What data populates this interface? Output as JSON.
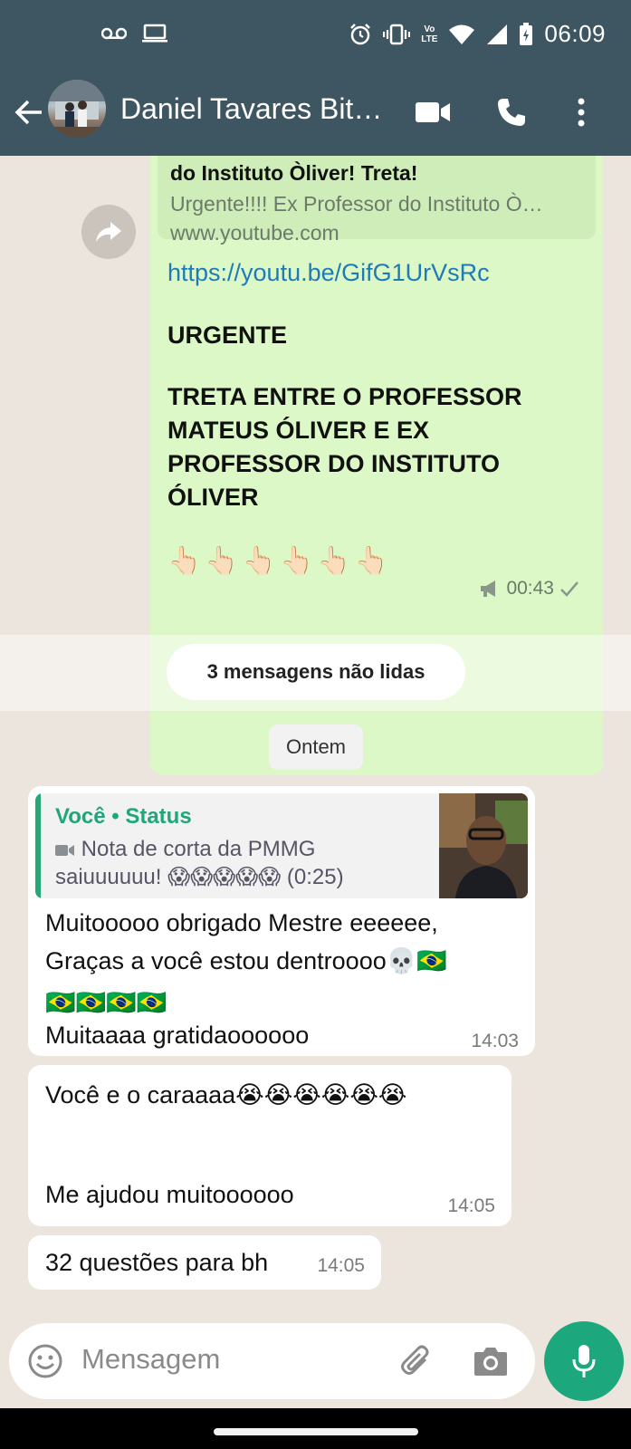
{
  "status_bar": {
    "time": "06:09",
    "network_label_top": "Vo",
    "network_label_bottom": "LTE"
  },
  "header": {
    "contact_name": "Daniel Tavares Bit…",
    "icons": [
      "back-arrow-icon",
      "video-call-icon",
      "phone-icon",
      "more-vert-icon"
    ]
  },
  "outgoing_message": {
    "link_preview": {
      "title": "do Instituto Òliver! Treta!",
      "description": "Urgente!!!! Ex Professor do Instituto Ò…",
      "domain": "www.youtube.com"
    },
    "link_url": "https://youtu.be/GifG1UrVsRc",
    "line_urgente": "URGENTE",
    "line_treta_1": "TRETA ENTRE O PROFESSOR",
    "line_treta_2": "MATEUS ÓLIVER E EX",
    "line_treta_3": "PROFESSOR DO INSTITUTO",
    "line_treta_4": "ÓLIVER",
    "pointers": "👆🏻👆🏻👆🏻👆🏻👆🏻👆🏻",
    "time": "00:43"
  },
  "unread_banner": "3 mensagens não lidas",
  "date_chip": "Ontem",
  "incoming_messages": [
    {
      "quote_author": "Você • Status",
      "quote_text": "Nota de corta da PMMG saiuuuuuu! 😱😱😱😱😱 (0:25)",
      "line1": "Muitooooo obrigado Mestre eeeeee,",
      "line2": "Graças a você estou dentroooo💀🇧🇷",
      "line3": "🇧🇷🇧🇷🇧🇷🇧🇷",
      "line4": "Muitaaaa gratidaoooooo",
      "time": "14:03"
    },
    {
      "line1": "Você e o caraaaa😭😭😭😭😭😭",
      "line2": "Me ajudou muitoooooo",
      "time": "14:05"
    },
    {
      "line1": "32 questões para bh",
      "time": "14:05"
    }
  ],
  "composer": {
    "placeholder": "Mensagem"
  },
  "colors": {
    "header": "#3E5562",
    "outgoing_bubble": "#DCF8C6",
    "link": "#1E7BB8",
    "accent_green": "#1DA77C",
    "chat_background": "#ECE5DD"
  }
}
